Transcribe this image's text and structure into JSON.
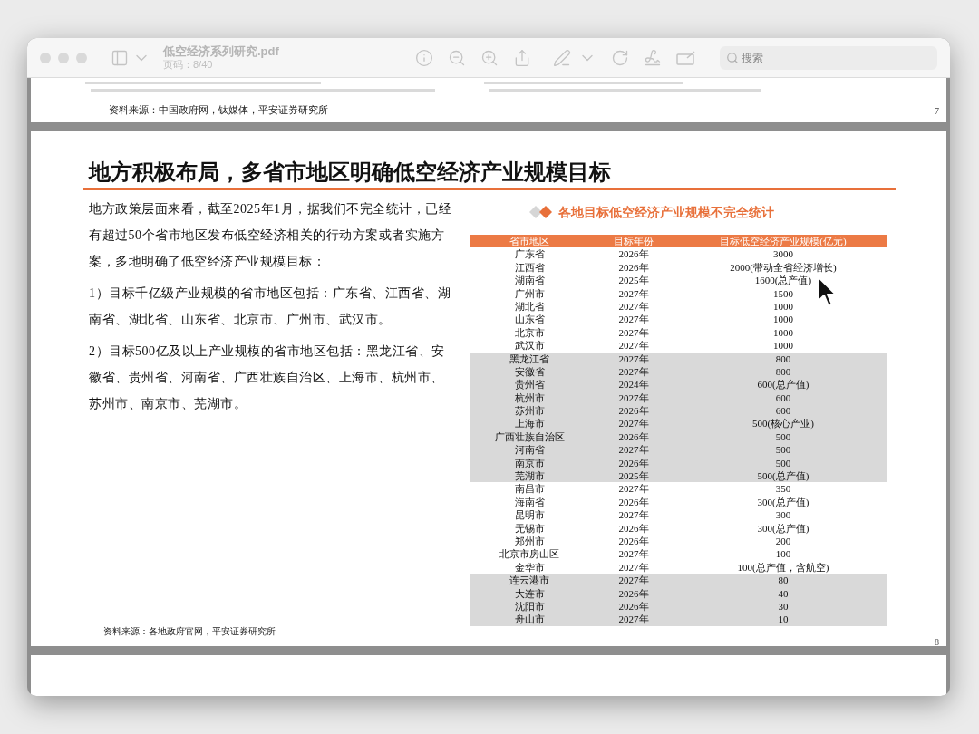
{
  "window": {
    "title": "低空经济系列研究.pdf",
    "page_indicator": "页码：8/40",
    "search": {
      "placeholder": "搜索"
    }
  },
  "previous_page": {
    "source": "资料来源：中国政府网，钛媒体，平安证券研究所",
    "page_number": "7"
  },
  "page": {
    "heading": "地方积极布局，多省市地区明确低空经济产业规模目标",
    "paragraphs": [
      "地方政策层面来看，截至2025年1月，据我们不完全统计，已经有超过50个省市地区发布低空经济相关的行动方案或者实施方案，多地明确了低空经济产业规模目标：",
      "1）目标千亿级产业规模的省市地区包括：广东省、江西省、湖南省、湖北省、山东省、北京市、广州市、武汉市。",
      "2）目标500亿及以上产业规模的省市地区包括：黑龙江省、安徽省、贵州省、河南省、广西壮族自治区、上海市、杭州市、苏州市、南京市、芜湖市。"
    ],
    "table": {
      "caption": "各地目标低空经济产业规模不完全统计",
      "columns": [
        "省市地区",
        "目标年份",
        "目标低空经济产业规模(亿元)"
      ],
      "rows": [
        {
          "cells": [
            "广东省",
            "2026年",
            "3000"
          ],
          "shaded": false
        },
        {
          "cells": [
            "江西省",
            "2026年",
            "2000(带动全省经济增长)"
          ],
          "shaded": false
        },
        {
          "cells": [
            "湖南省",
            "2025年",
            "1600(总产值)"
          ],
          "shaded": false
        },
        {
          "cells": [
            "广州市",
            "2027年",
            "1500"
          ],
          "shaded": false
        },
        {
          "cells": [
            "湖北省",
            "2027年",
            "1000"
          ],
          "shaded": false
        },
        {
          "cells": [
            "山东省",
            "2027年",
            "1000"
          ],
          "shaded": false
        },
        {
          "cells": [
            "北京市",
            "2027年",
            "1000"
          ],
          "shaded": false
        },
        {
          "cells": [
            "武汉市",
            "2027年",
            "1000"
          ],
          "shaded": false
        },
        {
          "cells": [
            "黑龙江省",
            "2027年",
            "800"
          ],
          "shaded": true
        },
        {
          "cells": [
            "安徽省",
            "2027年",
            "800"
          ],
          "shaded": true
        },
        {
          "cells": [
            "贵州省",
            "2024年",
            "600(总产值)"
          ],
          "shaded": true
        },
        {
          "cells": [
            "杭州市",
            "2027年",
            "600"
          ],
          "shaded": true
        },
        {
          "cells": [
            "苏州市",
            "2026年",
            "600"
          ],
          "shaded": true
        },
        {
          "cells": [
            "上海市",
            "2027年",
            "500(核心产业)"
          ],
          "shaded": true
        },
        {
          "cells": [
            "广西壮族自治区",
            "2026年",
            "500"
          ],
          "shaded": true
        },
        {
          "cells": [
            "河南省",
            "2027年",
            "500"
          ],
          "shaded": true
        },
        {
          "cells": [
            "南京市",
            "2026年",
            "500"
          ],
          "shaded": true
        },
        {
          "cells": [
            "芜湖市",
            "2025年",
            "500(总产值)"
          ],
          "shaded": true
        },
        {
          "cells": [
            "南昌市",
            "2027年",
            "350"
          ],
          "shaded": false
        },
        {
          "cells": [
            "海南省",
            "2026年",
            "300(总产值)"
          ],
          "shaded": false
        },
        {
          "cells": [
            "昆明市",
            "2027年",
            "300"
          ],
          "shaded": false
        },
        {
          "cells": [
            "无锡市",
            "2026年",
            "300(总产值)"
          ],
          "shaded": false
        },
        {
          "cells": [
            "郑州市",
            "2026年",
            "200"
          ],
          "shaded": false
        },
        {
          "cells": [
            "北京市房山区",
            "2027年",
            "100"
          ],
          "shaded": false
        },
        {
          "cells": [
            "金华市",
            "2027年",
            "100(总产值，含航空)"
          ],
          "shaded": false
        },
        {
          "cells": [
            "连云港市",
            "2027年",
            "80"
          ],
          "shaded": true
        },
        {
          "cells": [
            "大连市",
            "2026年",
            "40"
          ],
          "shaded": true
        },
        {
          "cells": [
            "沈阳市",
            "2026年",
            "30"
          ],
          "shaded": true
        },
        {
          "cells": [
            "舟山市",
            "2027年",
            "10"
          ],
          "shaded": true
        }
      ]
    },
    "source": "资料来源：各地政府官网，平安证券研究所",
    "page_number": "8"
  }
}
